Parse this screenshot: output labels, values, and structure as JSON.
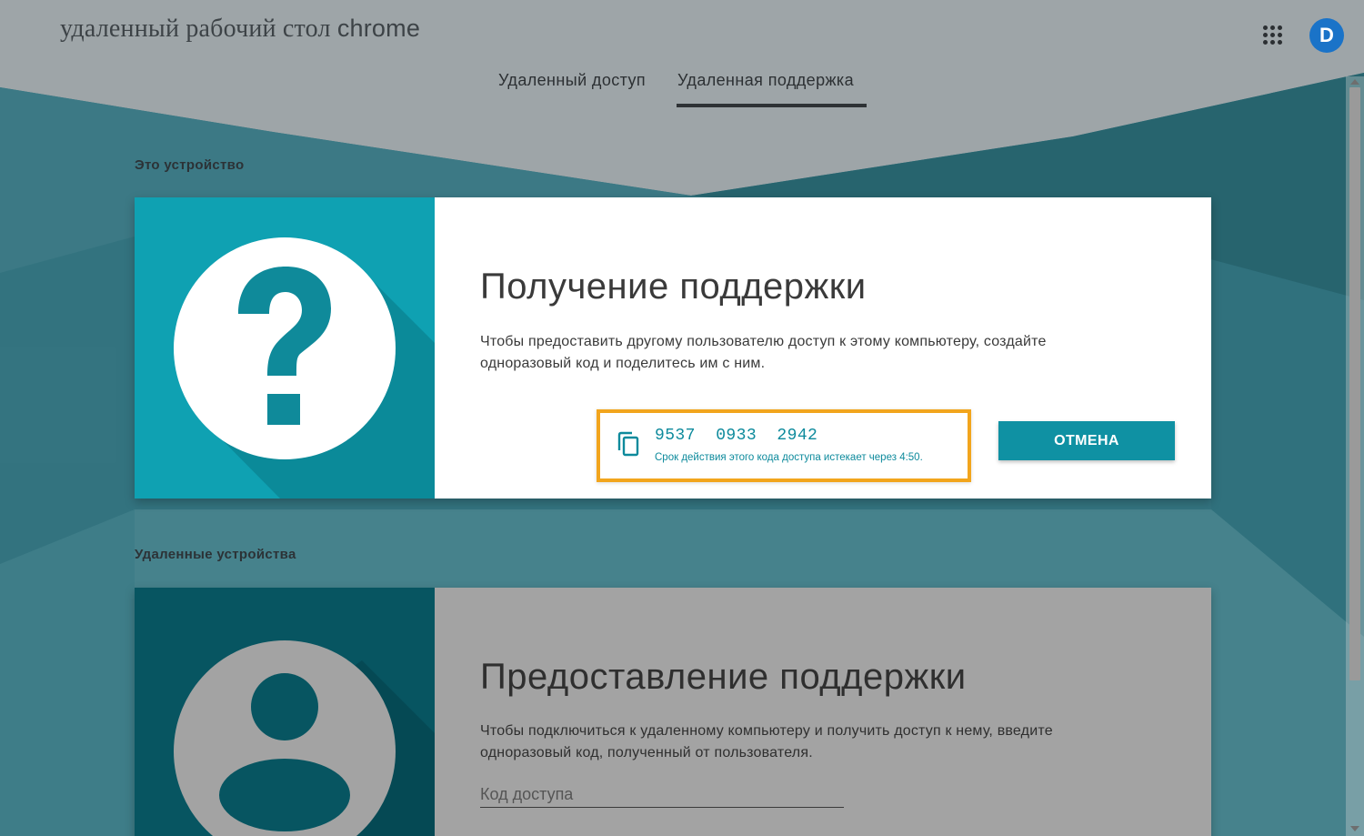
{
  "header": {
    "app_title_prefix": "удаленный рабочий стол ",
    "app_title_brand": "chrome",
    "apps_icon": "apps-grid-icon",
    "avatar_letter": "D"
  },
  "tabs": [
    {
      "label": "Удаленный доступ",
      "active": false
    },
    {
      "label": "Удаленная поддержка",
      "active": true
    }
  ],
  "this_device": {
    "section_label": "Это устройство",
    "icon": "help-question-icon",
    "title": "Получение поддержки",
    "description": "Чтобы предоставить другому пользователю доступ к этому компьютеру, создайте одноразовый код и поделитесь им с ним.",
    "access_code": "9537  0933  2942",
    "expiry_text": "Срок действия этого кода доступа истекает через 4:50.",
    "cancel_label": "ОТМЕНА"
  },
  "remote_devices": {
    "section_label": "Удаленные устройства",
    "icon": "person-icon",
    "title": "Предоставление поддержки",
    "description": "Чтобы подключиться к удаленному компьютеру и получить доступ к нему, введите одноразовый код, полученный от пользователя.",
    "code_input_placeholder": "Код доступа"
  },
  "colors": {
    "accent": "#0f91a3",
    "highlight_border": "#f2a51d",
    "avatar": "#1a73c8"
  }
}
